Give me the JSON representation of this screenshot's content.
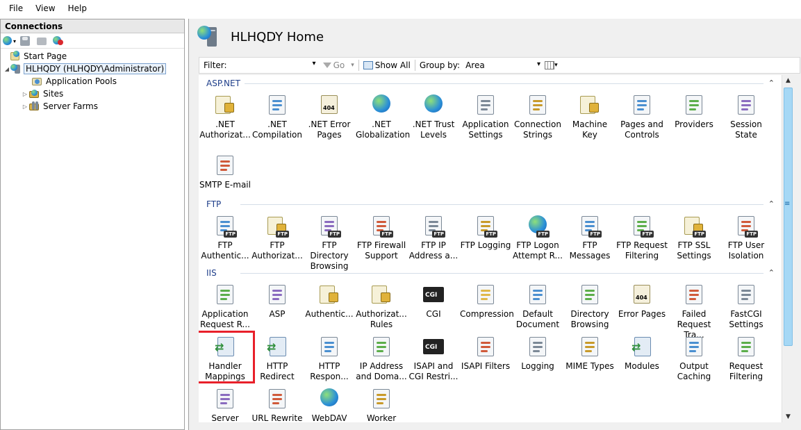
{
  "menu": [
    "File",
    "View",
    "Help"
  ],
  "connections": {
    "title": "Connections",
    "tree": [
      {
        "label": "Start Page",
        "indent": 0
      },
      {
        "label": "HLHQDY (HLHQDY\\Administrator)",
        "indent": 0,
        "selected": true
      },
      {
        "label": "Application Pools",
        "indent": 1
      },
      {
        "label": "Sites",
        "indent": 1
      },
      {
        "label": "Server Farms",
        "indent": 1
      }
    ]
  },
  "home": {
    "title": "HLHQDY Home"
  },
  "filterbar": {
    "filter_label": "Filter:",
    "go_label": "Go",
    "show_all_label": "Show All",
    "group_by_label": "Group by:",
    "group_by_value": "Area"
  },
  "groups": [
    {
      "name": "ASP.NET",
      "items": [
        {
          "label": ".NET Authorizat...",
          "icon": "lock-doc-icon"
        },
        {
          "label": ".NET Compilation",
          "icon": "stack-icon"
        },
        {
          "label": ".NET Error Pages",
          "icon": "error-404-icon"
        },
        {
          "label": ".NET Globalization",
          "icon": "globe-icon"
        },
        {
          "label": ".NET Trust Levels",
          "icon": "globe-check-icon"
        },
        {
          "label": "Application Settings",
          "icon": "checklist-icon"
        },
        {
          "label": "Connection Strings",
          "icon": "database-icon"
        },
        {
          "label": "Machine Key",
          "icon": "server-key-icon"
        },
        {
          "label": "Pages and Controls",
          "icon": "pages-icon"
        },
        {
          "label": "Providers",
          "icon": "users-db-icon"
        },
        {
          "label": "Session State",
          "icon": "user-session-icon"
        },
        {
          "label": "SMTP E-mail",
          "icon": "email-icon"
        }
      ]
    },
    {
      "name": "FTP",
      "items": [
        {
          "label": "FTP Authentic...",
          "icon": "ftp-user-icon"
        },
        {
          "label": "FTP Authorizat...",
          "icon": "ftp-key-icon"
        },
        {
          "label": "FTP Directory Browsing",
          "icon": "ftp-browse-icon"
        },
        {
          "label": "FTP Firewall Support",
          "icon": "ftp-firewall-icon"
        },
        {
          "label": "FTP IP Address a...",
          "icon": "ftp-ip-icon"
        },
        {
          "label": "FTP Logging",
          "icon": "ftp-log-icon"
        },
        {
          "label": "FTP Logon Attempt R...",
          "icon": "ftp-globe-icon"
        },
        {
          "label": "FTP Messages",
          "icon": "ftp-messages-icon"
        },
        {
          "label": "FTP Request Filtering",
          "icon": "ftp-filter-icon"
        },
        {
          "label": "FTP SSL Settings",
          "icon": "ftp-lock-icon"
        },
        {
          "label": "FTP User Isolation",
          "icon": "ftp-isolation-icon"
        }
      ]
    },
    {
      "name": "IIS",
      "items": [
        {
          "label": "Application Request R...",
          "icon": "arr-server-icon"
        },
        {
          "label": "ASP",
          "icon": "asp-icon"
        },
        {
          "label": "Authentic...",
          "icon": "authentication-icon"
        },
        {
          "label": "Authorizat... Rules",
          "icon": "authorization-icon"
        },
        {
          "label": "CGI",
          "icon": "cgi-icon"
        },
        {
          "label": "Compression",
          "icon": "compression-icon"
        },
        {
          "label": "Default Document",
          "icon": "default-doc-icon"
        },
        {
          "label": "Directory Browsing",
          "icon": "browse-icon"
        },
        {
          "label": "Error Pages",
          "icon": "error-pages-icon"
        },
        {
          "label": "Failed Request Tra...",
          "icon": "failed-request-icon"
        },
        {
          "label": "FastCGI Settings",
          "icon": "fastcgi-icon"
        },
        {
          "label": "Handler Mappings",
          "icon": "handler-mappings-icon",
          "highlight": true
        },
        {
          "label": "HTTP Redirect",
          "icon": "redirect-icon"
        },
        {
          "label": "HTTP Respon...",
          "icon": "http-response-icon"
        },
        {
          "label": "IP Address and Doma...",
          "icon": "ip-restrict-icon"
        },
        {
          "label": "ISAPI and CGI Restri...",
          "icon": "isapi-cgi-icon"
        },
        {
          "label": "ISAPI Filters",
          "icon": "isapi-filter-icon"
        },
        {
          "label": "Logging",
          "icon": "logging-icon"
        },
        {
          "label": "MIME Types",
          "icon": "mime-icon"
        },
        {
          "label": "Modules",
          "icon": "modules-icon"
        },
        {
          "label": "Output Caching",
          "icon": "output-cache-icon"
        },
        {
          "label": "Request Filtering",
          "icon": "request-filter-icon"
        },
        {
          "label": "Server Certific...",
          "icon": "certificate-icon"
        },
        {
          "label": "URL Rewrite",
          "icon": "url-rewrite-icon"
        },
        {
          "label": "WebDAV Authori...",
          "icon": "webdav-icon"
        },
        {
          "label": "Worker Processes",
          "icon": "worker-icon"
        }
      ]
    }
  ],
  "colors": {
    "highlight": "#e8202a",
    "group_title": "#1e3e8a",
    "scroll_thumb": "#a6d8f5"
  }
}
